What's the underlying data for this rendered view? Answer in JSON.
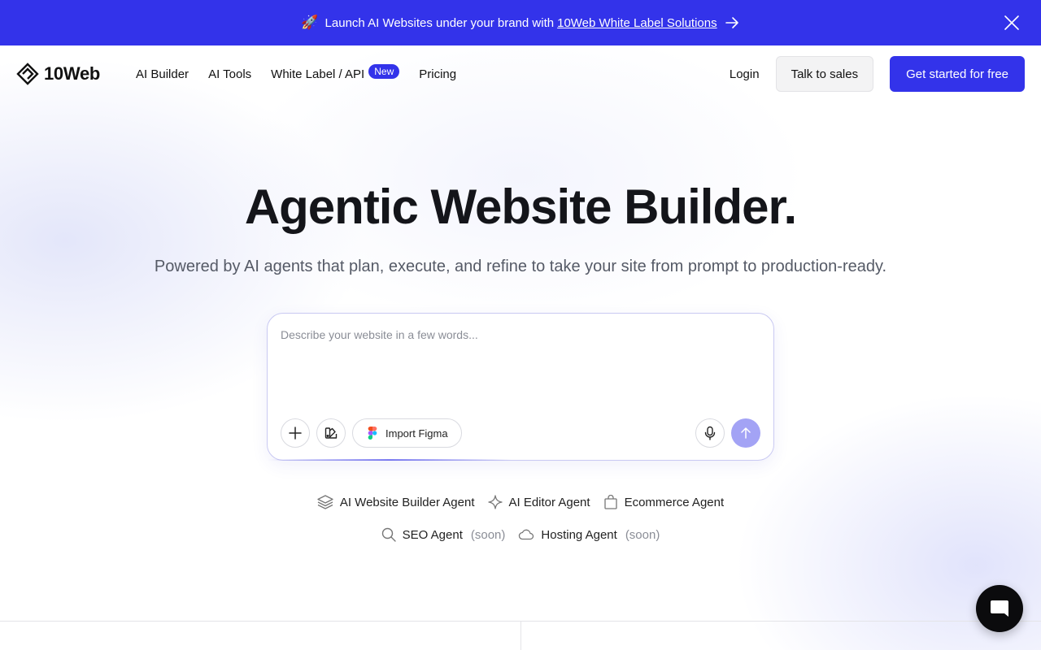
{
  "announcement": {
    "emoji": "🚀",
    "text": "Launch AI Websites under your brand with",
    "link": "10Web White Label Solutions"
  },
  "nav": {
    "logo": "10Web",
    "links": [
      "AI Builder",
      "AI Tools",
      "White Label / API",
      "Pricing"
    ],
    "badge": "New",
    "login": "Login",
    "sales": "Talk to sales",
    "cta": "Get started for free"
  },
  "hero": {
    "title": "Agentic Website Builder.",
    "subtitle": "Powered by AI agents that plan, execute, and refine to take your site from prompt to production-ready."
  },
  "prompt": {
    "placeholder": "Describe your website in a few words...",
    "figma_label": "Import Figma"
  },
  "agents": {
    "row1": [
      "AI Website Builder Agent",
      "AI Editor Agent",
      "Ecommerce Agent"
    ],
    "row2": [
      "SEO Agent",
      "Hosting Agent"
    ],
    "soon": "(soon)"
  },
  "colors": {
    "brand": "#3333ea",
    "send_disabled": "#a3a3f5"
  }
}
